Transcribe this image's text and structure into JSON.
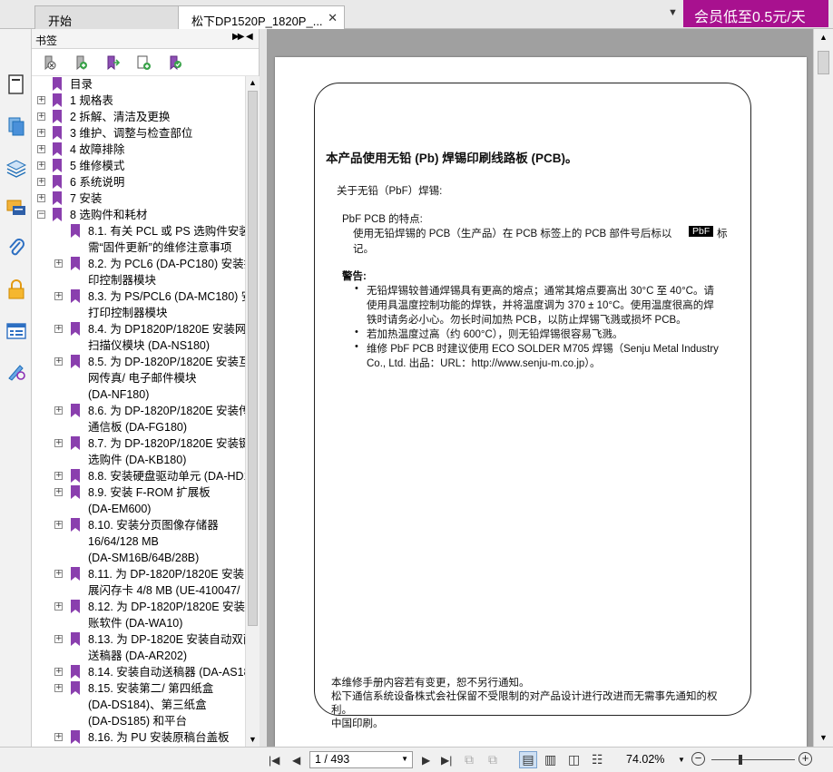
{
  "tabs": {
    "start_label": "开始",
    "doc_label": "松下DP1520P_1820P_...",
    "close_glyph": "✕"
  },
  "promo": {
    "text": "会员低至0.5元/天",
    "color": "#a8118f"
  },
  "panel": {
    "title": "书签"
  },
  "bookmarks": [
    "目录",
    "1 规格表",
    "2 拆解、清洁及更换",
    "3 维护、调整与检查部位",
    "4 故障排除",
    "5 维修模式",
    "6 系统说明",
    "7 安装",
    "8 选购件和耗材",
    "8.1. 有关 PCL 或 PS 选购件安装,",
    "需“固件更新”的维修注意事项",
    "8.2. 为 PCL6 (DA-PC180) 安装打",
    "印控制器模块",
    "8.3. 为 PS/PCL6 (DA-MC180) 安",
    "打印控制器模块",
    "8.4. 为 DP1820P/1820E 安装网",
    "扫描仪模块 (DA-NS180)",
    "8.5. 为 DP-1820P/1820E 安装互",
    "网传真/ 电子邮件模块",
    "(DA-NF180)",
    "8.6. 为 DP-1820P/1820E 安装传",
    "通信板 (DA-FG180)",
    "8.7. 为 DP-1820P/1820E 安装键",
    "选购件 (DA-KB180)",
    "8.8. 安装硬盘驱动单元 (DA-HD1",
    "8.9. 安装 F-ROM 扩展板",
    "(DA-EM600)",
    "8.10. 安装分页图像存储器",
    "16/64/128 MB",
    "(DA-SM16B/64B/28B)",
    "8.11. 为 DP-1820P/1820E 安装",
    "展闪存卡 4/8 MB (UE-410047/",
    "8.12. 为 DP-1820P/1820E 安装",
    "账软件 (DA-WA10)",
    "8.13. 为 DP-1820E 安装自动双面",
    "送稿器 (DA-AR202)",
    "8.14. 安装自动送稿器 (DA-AS18",
    "8.15. 安装第二/ 第四纸盒",
    "(DA-DS184)、第三纸盒",
    "(DA-DS185) 和平台",
    "8.16. 为 PU 安装原稿台盖板"
  ],
  "doc": {
    "heading": "本产品使用无铅 (Pb) 焊锡印刷线路板 (PCB)。",
    "about": "关于无铅（PbF）焊锡:",
    "pbf_title": "PbF PCB 的特点:",
    "pbf_text_1": "使用无铅焊锡的 PCB（生产品）在 PCB 标签上的 PCB 部件号后标以",
    "pbf_badge": "PbF",
    "pbf_tail": "标",
    "pbf_text_2": "记。",
    "warn_title": "警告:",
    "bullet": "•",
    "warnings": [
      "无铅焊锡较普通焊锡具有更高的熔点；通常其熔点要高出 30°C 至 40°C。请",
      "使用具温度控制功能的焊铁，并将温度调为 370 ± 10°C。使用温度很高的焊",
      "铁时请务必小心。勿长时间加热 PCB，以防止焊锡飞溅或损坏 PCB。",
      "若加热温度过高（约 600°C），则无铅焊锡很容易飞溅。",
      "维修 PbF PCB 时建议使用 ECO SOLDER M705 焊锡（Senju Metal Industry",
      "Co., Ltd. 出品：URL：http://www.senju-m.co.jp）。"
    ],
    "footer": [
      "本维修手册内容若有变更，恕不另行通知。",
      "松下通信系统设备株式会社保留不受限制的对产品设计进行改进而无需事先通知的权",
      "利。",
      "中国印刷。"
    ]
  },
  "status": {
    "page_indicator": "1 / 493",
    "zoom": "74.02%",
    "zoom_out": "−",
    "zoom_in": "+"
  }
}
